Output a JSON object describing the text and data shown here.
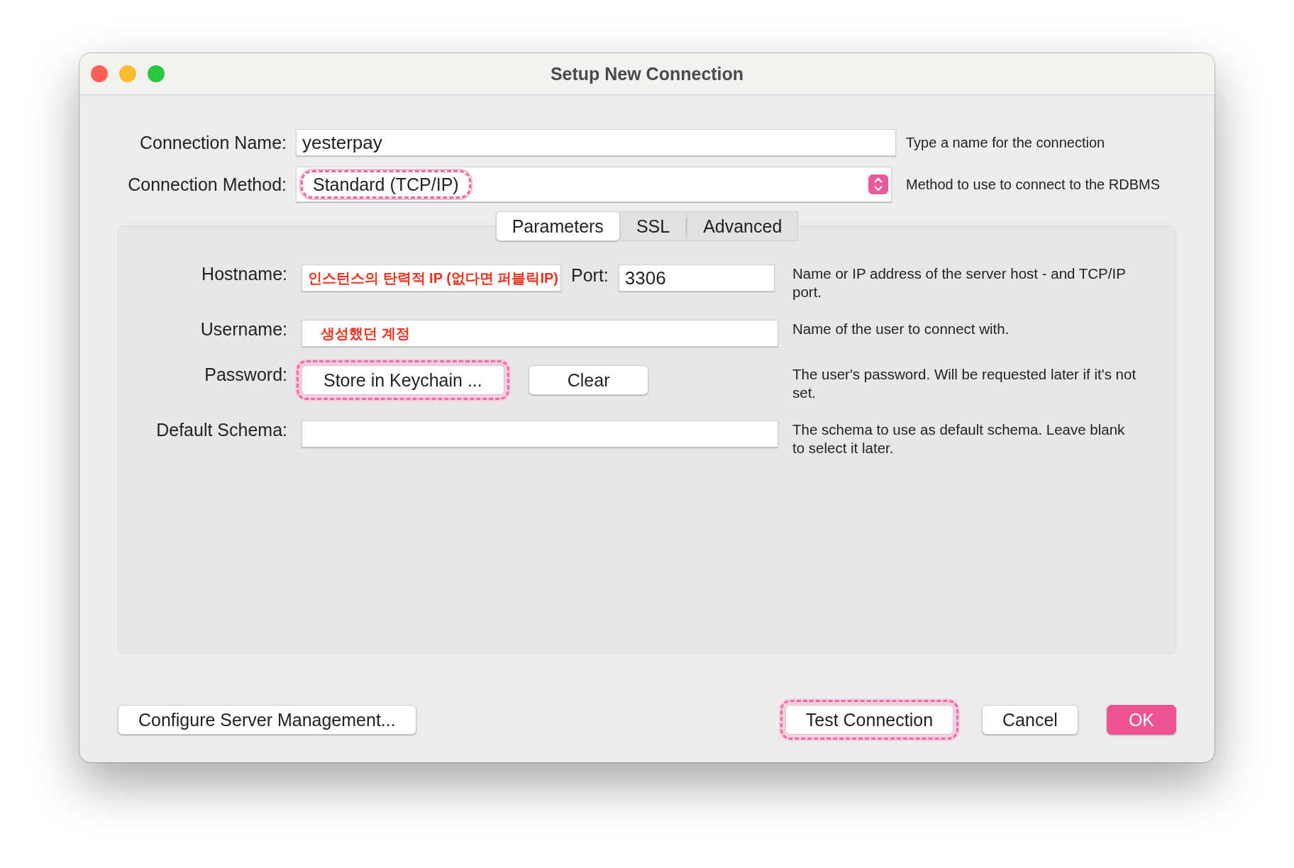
{
  "window": {
    "title": "Setup New Connection"
  },
  "connection_name": {
    "label": "Connection Name:",
    "value": "yesterpay",
    "hint": "Type a name for the connection"
  },
  "connection_method": {
    "label": "Connection Method:",
    "value": "Standard (TCP/IP)",
    "hint": "Method to use to connect to the RDBMS",
    "highlighted": true
  },
  "tabs": [
    {
      "label": "Parameters",
      "selected": true
    },
    {
      "label": "SSL",
      "selected": false
    },
    {
      "label": "Advanced",
      "selected": false
    }
  ],
  "parameters": {
    "hostname": {
      "label": "Hostname:",
      "value": "인스턴스의 탄력적 IP (없다면 퍼블릭IP)"
    },
    "port": {
      "label": "Port:",
      "value": "3306"
    },
    "hostname_hint": "Name or IP address of the server host - and TCP/IP port.",
    "username": {
      "label": "Username:",
      "value": "생성했던 계정",
      "hint": "Name of the user to connect with."
    },
    "password": {
      "label": "Password:",
      "buttons": [
        {
          "label": "Store in Keychain ...",
          "highlighted": true
        },
        {
          "label": "Clear",
          "highlighted": false
        }
      ],
      "hint": "The user's password. Will be requested later if it's not set."
    },
    "default_schema": {
      "label": "Default Schema:",
      "hint": "The schema to use as default schema. Leave blank to select it later."
    }
  },
  "buttons": [
    {
      "label": "Configure Server Management...",
      "kind": "plain",
      "highlighted": false
    },
    {
      "label": "Test Connection",
      "kind": "plain",
      "highlighted": true
    },
    {
      "label": "Cancel",
      "kind": "plain",
      "highlighted": false
    },
    {
      "label": "OK",
      "kind": "default",
      "highlighted": false
    }
  ]
}
